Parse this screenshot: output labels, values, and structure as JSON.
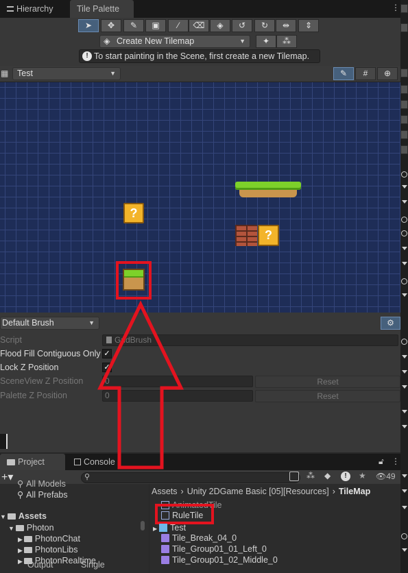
{
  "tabs": {
    "hierarchy": "Hierarchy",
    "tile_palette": "Tile Palette"
  },
  "toolbar": {
    "tools": [
      "select",
      "move",
      "paint",
      "box-fill",
      "pick",
      "erase",
      "fill",
      "rotate-left",
      "rotate-right",
      "flip-x",
      "flip-y"
    ]
  },
  "tilemap_dropdown": {
    "value": "Create New Tilemap"
  },
  "info": {
    "message": "To start painting in the Scene, first create a new Tilemap."
  },
  "palette": {
    "selected": "Test"
  },
  "brush": {
    "name": "Default Brush",
    "script_label": "Script",
    "script_value": "GridBrush",
    "flood_fill_label": "Flood Fill Contiguous Only",
    "flood_fill_checked": true,
    "lock_z_label": "Lock Z Position",
    "lock_z_checked": true,
    "scene_z_label": "SceneView Z Position",
    "scene_z_value": "0",
    "scene_reset": "Reset",
    "palette_z_label": "Palette Z Position",
    "palette_z_value": "0",
    "palette_reset": "Reset"
  },
  "project": {
    "tab_project": "Project",
    "tab_console": "Console",
    "count": "49",
    "breadcrumb": [
      "Assets",
      "Unity 2DGame Basic [05][Resources]",
      "TileMap"
    ],
    "tree": [
      "All Models",
      "All Prefabs",
      "Assets",
      "Photon",
      "PhotonChat",
      "PhotonLibs",
      "PhotonRealtime",
      "Output",
      "Single"
    ],
    "files": [
      "AnimatedTile",
      "RuleTile",
      "Test",
      "Tile_Break_04_0",
      "Tile_Group01_01_Left_0",
      "Tile_Group01_02_Middle_0"
    ]
  },
  "colors": {
    "accent": "#46607c",
    "highlight": "#e3131f",
    "grid": "#1e2d57"
  }
}
